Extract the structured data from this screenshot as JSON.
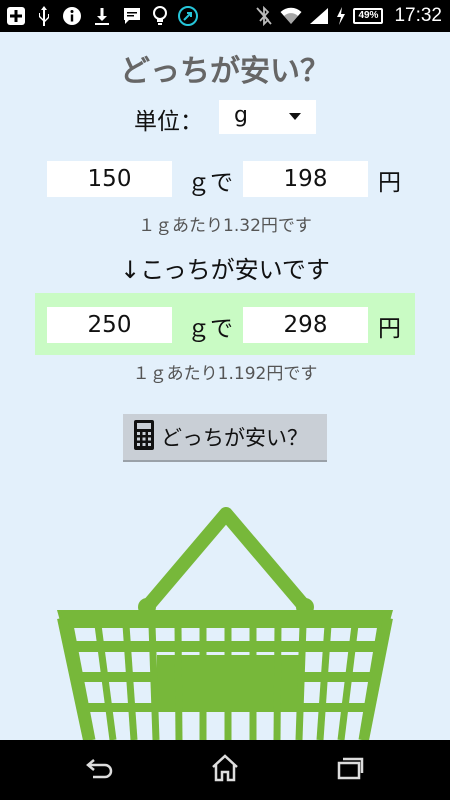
{
  "status_bar": {
    "time": "17:32",
    "battery": "49%",
    "icons": [
      "add-box-icon",
      "usb-icon",
      "info-icon",
      "download-icon",
      "message-icon",
      "bulb-icon",
      "arrow-circle-icon",
      "bluetooth-off-icon",
      "wifi-icon",
      "signal-icon",
      "charging-icon",
      "battery-icon"
    ]
  },
  "app": {
    "title": "どっちが安い？",
    "unit_label": "単位：",
    "unit_value": "g",
    "item1": {
      "quantity": "150",
      "unit_suffix": "ｇで",
      "price": "198",
      "currency": "円",
      "per_unit": "１ｇあたり1.32円です"
    },
    "result_text": "↓こっちが安いです",
    "item2": {
      "quantity": "250",
      "unit_suffix": "ｇで",
      "price": "298",
      "currency": "円",
      "per_unit": "１ｇあたり1.192円です"
    },
    "compare_button": "どっちが安い？"
  },
  "colors": {
    "background": "#e3f0fb",
    "highlight": "#c9fbc4",
    "basket": "#77b83a",
    "button": "#c9cfd6"
  },
  "navigation": {
    "icons": [
      "back-icon",
      "home-icon",
      "recent-apps-icon"
    ]
  }
}
